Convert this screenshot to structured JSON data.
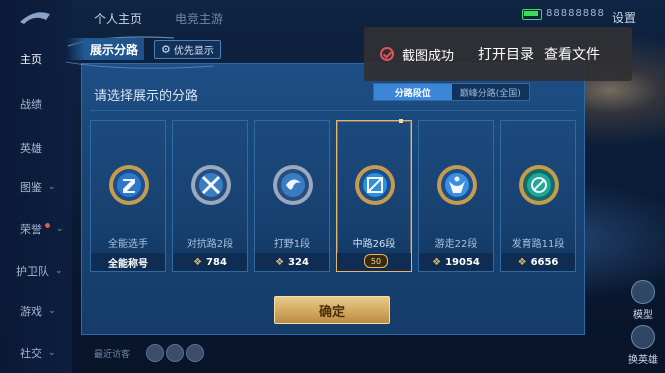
{
  "top_nav": {
    "personal_home": "个人主页",
    "esports_home": "电竞主游"
  },
  "settings_label": "设置",
  "status_digits": "88888888",
  "sidebar": {
    "items": [
      {
        "label": "主页",
        "active": true
      },
      {
        "label": "战绩"
      },
      {
        "label": "英雄"
      },
      {
        "label": "图鉴"
      },
      {
        "label": "荣誉"
      },
      {
        "label": "护卫队"
      },
      {
        "label": "游戏"
      },
      {
        "label": "社交"
      }
    ]
  },
  "right_buttons": {
    "model": "模型",
    "change_hero": "换英雄"
  },
  "recent_visitors": "最近访客",
  "toast": {
    "message": "截图成功",
    "open_dir": "打开目录",
    "view_file": "查看文件"
  },
  "modal": {
    "title": "展示分路",
    "priority_button": "优先显示",
    "subtitle": "请选择展示的分路",
    "tabs": [
      {
        "label": "分路段位",
        "active": true
      },
      {
        "label": "巅峰分路(全国)",
        "active": false
      }
    ],
    "cards": [
      {
        "name": "全能选手",
        "footer": "全能称号",
        "show_gem": false,
        "emblem_color": "#2f77c9",
        "selected": false
      },
      {
        "name": "对抗路2段",
        "footer": "784",
        "show_gem": true,
        "emblem_color": "#3a7cc4",
        "selected": false
      },
      {
        "name": "打野1段",
        "footer": "324",
        "show_gem": true,
        "emblem_color": "#3a7cc4",
        "selected": false
      },
      {
        "name": "中路26段",
        "footer": "",
        "show_gem": false,
        "emblem_color": "#2f8fd9",
        "selected": true,
        "badge": "50"
      },
      {
        "name": "游走22段",
        "footer": "19054",
        "show_gem": true,
        "emblem_color": "#3c8fe0",
        "selected": false
      },
      {
        "name": "发育路11段",
        "footer": "6656",
        "show_gem": true,
        "emblem_color": "#1fa79a",
        "selected": false
      }
    ],
    "confirm": "确定"
  }
}
